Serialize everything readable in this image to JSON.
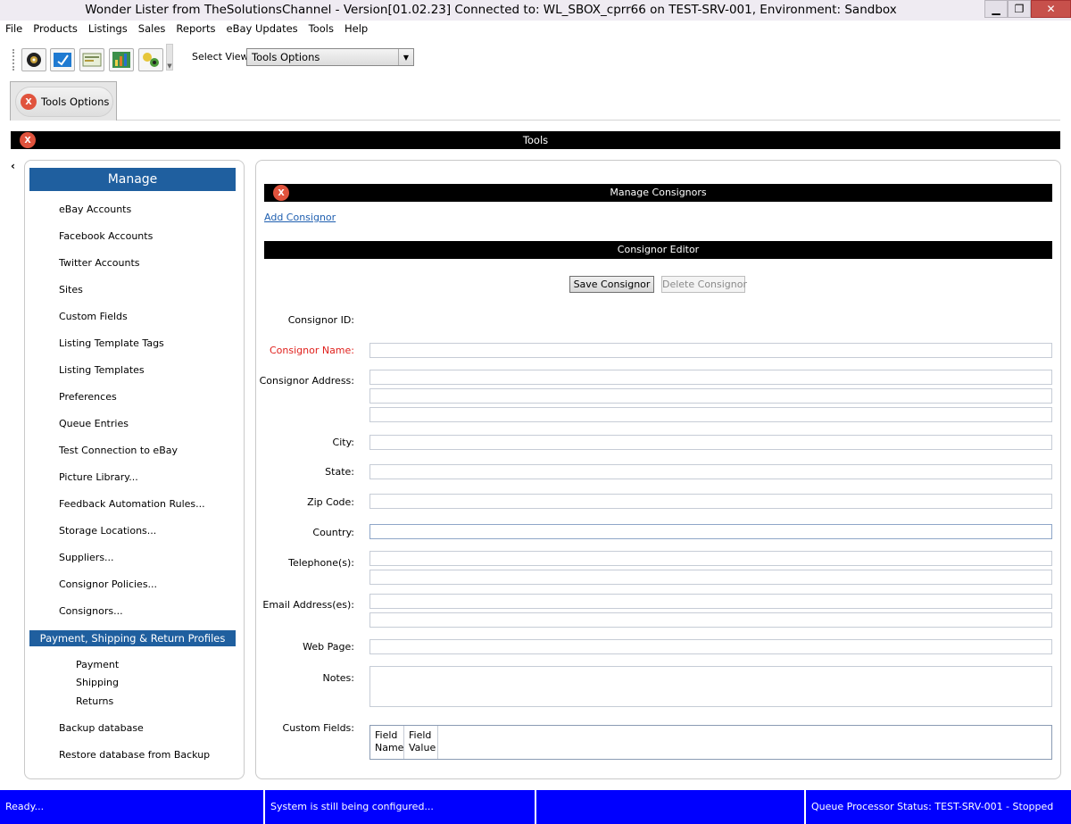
{
  "window": {
    "title": "Wonder Lister from TheSolutionsChannel - Version[01.02.23] Connected to: WL_SBOX_cprr66 on TEST-SRV-001, Environment: Sandbox"
  },
  "menu": [
    "File",
    "Products",
    "Listings",
    "Sales",
    "Reports",
    "eBay Updates",
    "Tools",
    "Help"
  ],
  "toolbar": {
    "icons": [
      "products-icon",
      "listings-icon",
      "sales-icon",
      "reports-icon",
      "tools-icon"
    ],
    "select_view_label": "Select View:",
    "select_view_value": "Tools Options"
  },
  "tabs": [
    {
      "label": "Tools Options",
      "close_glyph": "X"
    }
  ],
  "tools_header": {
    "title": "Tools",
    "close_glyph": "X"
  },
  "sidebar": {
    "collapse_glyph": "‹",
    "manage_header": "Manage",
    "items": [
      "eBay Accounts",
      "Facebook Accounts",
      "Twitter Accounts",
      "Sites",
      "Custom Fields",
      "Listing Template Tags",
      "Listing Templates",
      "Preferences",
      "Queue Entries",
      "Test Connection to eBay",
      "Picture Library...",
      "Feedback Automation Rules...",
      "Storage Locations...",
      "Suppliers...",
      "Consignor Policies...",
      "Consignors..."
    ],
    "profiles_header": "Payment, Shipping & Return Profiles",
    "profile_items": [
      "Payment",
      "Shipping",
      "Returns"
    ],
    "bottom_items": [
      "Backup database",
      "Restore database from Backup"
    ]
  },
  "main": {
    "manage_consignors_title": "Manage Consignors",
    "close_glyph": "X",
    "add_consignor_link": "Add Consignor",
    "editor_title": "Consignor Editor",
    "save_button": "Save Consignor",
    "delete_button": "Delete Consignor",
    "labels": {
      "id": "Consignor ID:",
      "name": "Consignor Name:",
      "address": "Consignor Address:",
      "city": "City:",
      "state": "State:",
      "zip": "Zip Code:",
      "country": "Country:",
      "telephone": "Telephone(s):",
      "email": "Email Address(es):",
      "web": "Web Page:",
      "notes": "Notes:",
      "custom": "Custom Fields:"
    },
    "values": {
      "id": "",
      "name": "",
      "address1": "",
      "address2": "",
      "address3": "",
      "city": "",
      "state": "",
      "zip": "",
      "country": "",
      "phone1": "",
      "phone2": "",
      "email1": "",
      "email2": "",
      "web": "",
      "notes": ""
    },
    "custom_fields_columns": [
      "Field Name",
      "Field Value"
    ],
    "required_color": "#e0201c"
  },
  "status": {
    "left": "Ready...",
    "middle": "System is still being configured...",
    "middle2": "",
    "right": "Queue Processor Status: TEST-SRV-001 - Stopped",
    "bg_color": "#0000ff"
  }
}
